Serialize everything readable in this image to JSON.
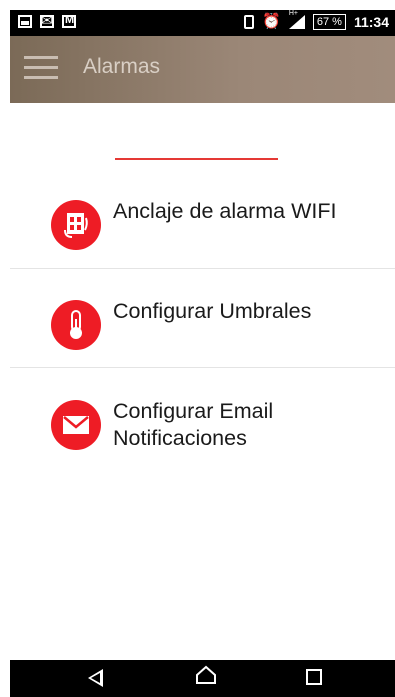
{
  "status_bar": {
    "battery": "67 %",
    "time": "11:34",
    "network_label": "H+"
  },
  "app_bar": {
    "title": "Alarmas",
    "menu_icon": "hamburger-menu-icon"
  },
  "menu": {
    "items": [
      {
        "label": "Anclaje de alarma WIFI",
        "icon": "router-link-icon"
      },
      {
        "label": "Configurar Umbrales",
        "icon": "thermometer-icon"
      },
      {
        "label_line1": "Configurar Email",
        "label_line2": "Notificaciones",
        "icon": "envelope-icon"
      }
    ]
  },
  "nav_bar": {
    "back_icon": "back-triangle-icon",
    "home_icon": "home-icon",
    "recent_icon": "recent-apps-icon"
  },
  "colors": {
    "accent": "#ee1c25",
    "app_bar": "#9b8777",
    "status_bar": "#000000"
  }
}
